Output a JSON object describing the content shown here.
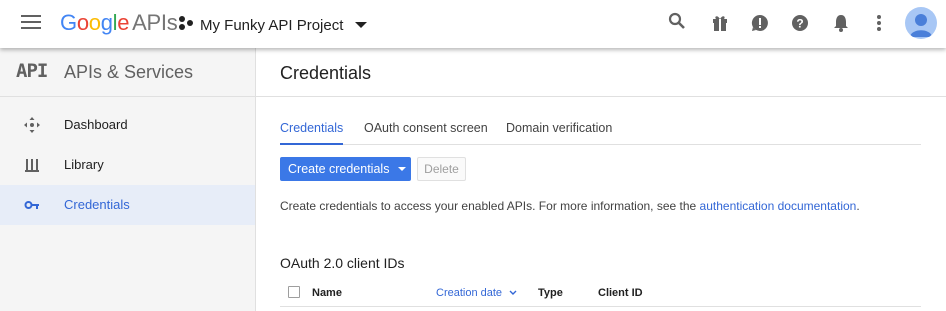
{
  "header": {
    "logo_google": "Google",
    "logo_apis": "APIs",
    "project_name": "My Funky API Project",
    "colors": {
      "g_blue": "#4285F4",
      "g_red": "#EA4335",
      "g_yellow": "#FBBC05",
      "g_green": "#34A853",
      "icon_gray": "#616161"
    },
    "icons": [
      "menu-icon",
      "search-icon",
      "gift-icon",
      "alert-icon",
      "help-icon",
      "notifications-icon",
      "more-vert-icon",
      "account-avatar"
    ]
  },
  "sidebar": {
    "badge": "API",
    "title": "APIs & Services",
    "items": [
      {
        "label": "Dashboard",
        "icon": "dashboard-icon"
      },
      {
        "label": "Library",
        "icon": "library-icon"
      },
      {
        "label": "Credentials",
        "icon": "key-icon",
        "active": true
      }
    ]
  },
  "main": {
    "title": "Credentials",
    "tabs": [
      {
        "label": "Credentials",
        "active": true
      },
      {
        "label": "OAuth consent screen"
      },
      {
        "label": "Domain verification"
      }
    ],
    "create_button": "Create credentials",
    "delete_button": "Delete",
    "info_text": "Create credentials to access your enabled APIs. For more information, see the ",
    "info_link": "authentication documentation",
    "info_end": ".",
    "section_title": "OAuth 2.0 client IDs",
    "table_columns": [
      "Name",
      "Creation date",
      "Type",
      "Client ID"
    ],
    "accent": "#3367d6"
  }
}
